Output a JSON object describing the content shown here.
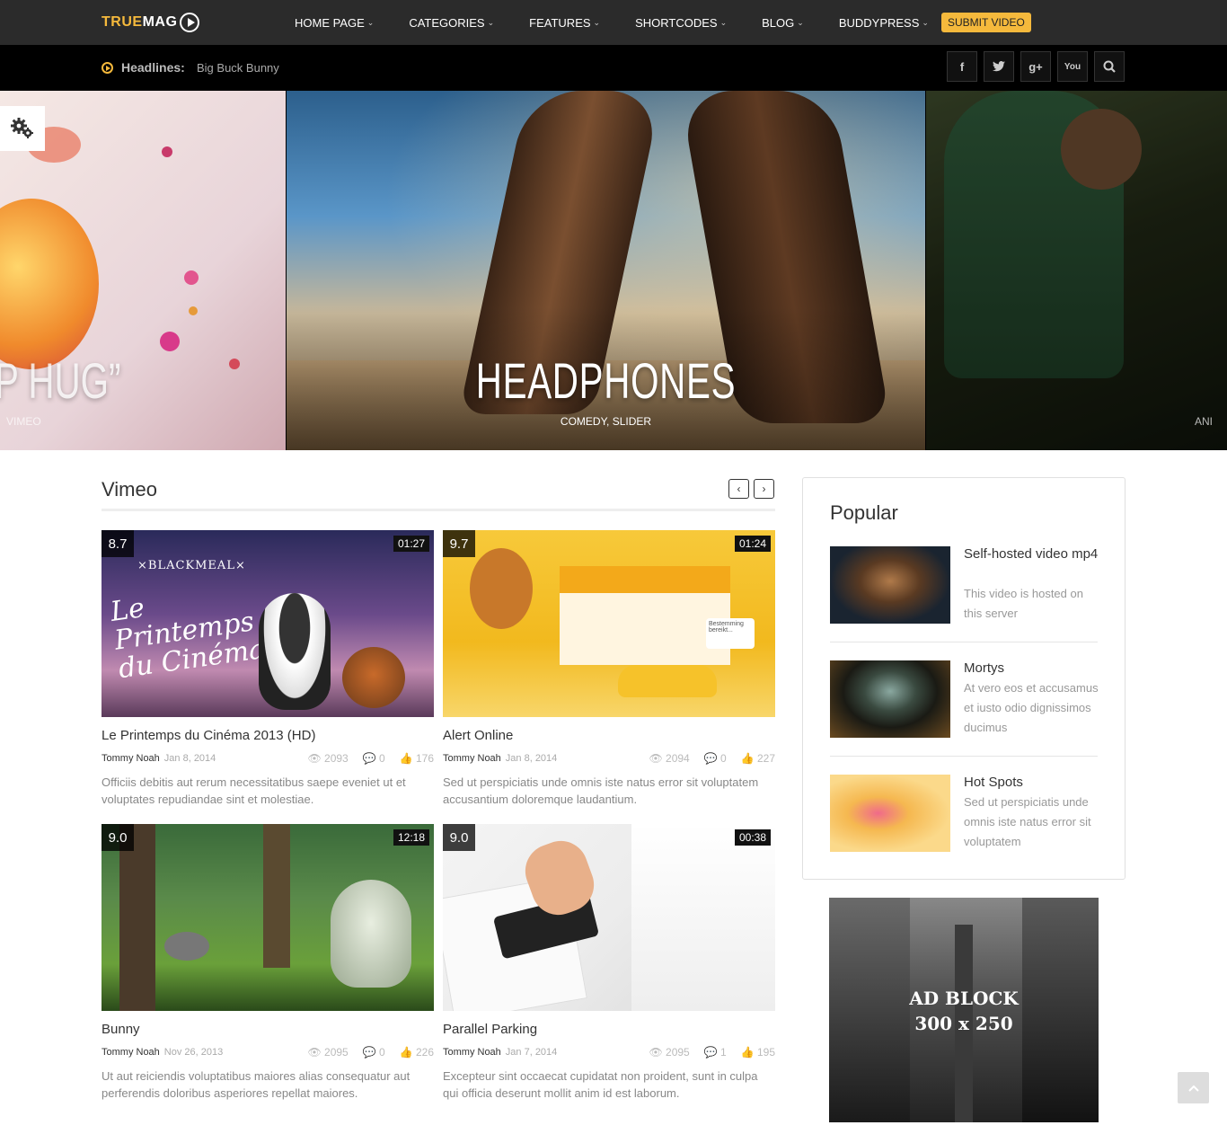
{
  "brand": {
    "logo_part1": "TRUE",
    "logo_part2": "MAG"
  },
  "nav": {
    "items": [
      "HOME PAGE",
      "CATEGORIES",
      "FEATURES",
      "SHORTCODES",
      "BLOG",
      "BUDDYPRESS"
    ],
    "submit_label": "SUBMIT VIDEO"
  },
  "headlines": {
    "label": "Headlines:",
    "text": "Big Buck Bunny"
  },
  "social": {
    "facebook": "f",
    "twitter": "t",
    "google": "g+",
    "youtube": "You",
    "search": "⌕"
  },
  "slider": {
    "left": {
      "title": "P HUG”",
      "cats": "VIMEO"
    },
    "center": {
      "title": "HEADPHONES",
      "cats": "COMEDY, SLIDER"
    },
    "right": {
      "cats": "ANI"
    }
  },
  "section": {
    "title": "Vimeo",
    "prev": "‹",
    "next": "›"
  },
  "videos": [
    {
      "title": "Le Printemps du Cinéma 2013 (HD)",
      "author": "Tommy Noah",
      "date": "Jan 8, 2014",
      "views": "2093",
      "comments": "0",
      "likes": "176",
      "score": "8.7",
      "duration": "01:27",
      "excerpt": "Officiis debitis aut rerum necessitatibus saepe eveniet ut et voluptates repudiandae sint et molestiae.",
      "thumb_text_1": "×BLACKMEAL×",
      "thumb_text_2": "Le Printemps du Cinéma"
    },
    {
      "title": "Alert Online",
      "author": "Tommy Noah",
      "date": "Jan 8, 2014",
      "views": "2094",
      "comments": "0",
      "likes": "227",
      "score": "9.7",
      "duration": "01:24",
      "excerpt": "Sed ut perspiciatis unde omnis iste natus error sit voluptatem accusantium doloremque laudantium.",
      "thumb_text_1": "Bestemming bereikt..."
    },
    {
      "title": "Bunny",
      "author": "Tommy Noah",
      "date": "Nov 26, 2013",
      "views": "2095",
      "comments": "0",
      "likes": "226",
      "score": "9.0",
      "duration": "12:18",
      "excerpt": "Ut aut reiciendis voluptatibus maiores alias consequatur aut perferendis doloribus asperiores repellat maiores."
    },
    {
      "title": "Parallel Parking",
      "author": "Tommy Noah",
      "date": "Jan 7, 2014",
      "views": "2095",
      "comments": "1",
      "likes": "195",
      "score": "9.0",
      "duration": "00:38",
      "excerpt": "Excepteur sint occaecat cupidatat non proident, sunt in culpa qui officia deserunt mollit anim id est laborum."
    }
  ],
  "popular": {
    "title": "Popular",
    "items": [
      {
        "title": "Self-hosted video mp4",
        "desc": "This video is hosted on this server"
      },
      {
        "title": "Mortys",
        "desc": "At vero eos et accusamus et iusto odio dignissimos ducimus"
      },
      {
        "title": "Hot Spots",
        "desc": "Sed ut perspiciatis unde omnis iste natus error sit voluptatem"
      }
    ]
  },
  "ad": {
    "line1": "AD BLOCK",
    "line2": "300 x 250"
  },
  "icons": {
    "views": "eye-icon",
    "comments": "comment-icon",
    "likes": "thumbs-up-icon"
  },
  "colors": {
    "accent": "#f5b93c",
    "topbar": "#2b2b2b",
    "headbar": "#000000"
  }
}
